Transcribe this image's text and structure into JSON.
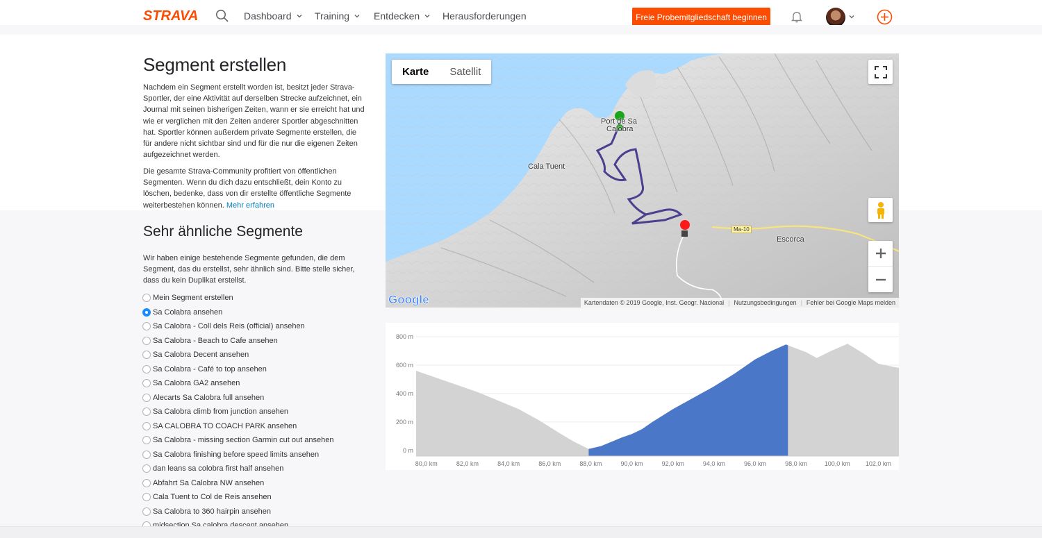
{
  "header": {
    "brand": "STRAVA",
    "nav": [
      {
        "label": "Dashboard",
        "has_dropdown": true
      },
      {
        "label": "Training",
        "has_dropdown": true
      },
      {
        "label": "Entdecken",
        "has_dropdown": true
      },
      {
        "label": "Herausforderungen",
        "has_dropdown": false
      }
    ],
    "cta": "Freie Probemitgliedschaft beginnen",
    "icons": [
      "search-icon",
      "bell-icon",
      "avatar",
      "chevron-down-icon",
      "plus-circle-icon"
    ],
    "brand_color": "#fc4c02"
  },
  "intro": {
    "title": "Segment erstellen",
    "p1": "Nachdem ein Segment erstellt worden ist, besitzt jeder Strava-Sportler, der eine Aktivität auf derselben Strecke aufzeichnet, ein Journal mit seinen bisherigen Zeiten, wann er sie erreicht hat und wie er verglichen mit den Zeiten anderer Sportler abgeschnitten hat. Sportler können außerdem private Segmente erstellen, die für andere nicht sichtbar sind und für die nur die eigenen Zeiten aufgezeichnet werden.",
    "p2": "Die gesamte Strava-Community profitiert von öffentlichen Segmenten. Wenn du dich dazu entschließt, dein Konto zu löschen, bedenke, dass von dir erstellte öffentliche Segmente weiterbestehen können.",
    "more_link": "Mehr erfahren"
  },
  "similar": {
    "title": "Sehr ähnliche Segmente",
    "description": "Wir haben einige bestehende Segmente gefunden, die dem Segment, das du erstellst, sehr ähnlich sind. Bitte stelle sicher, dass du kein Duplikat erstellst.",
    "selected_index": 1,
    "options": [
      "Mein Segment erstellen",
      "Sa Colabra ansehen",
      "Sa Calobra - Coll dels Reis (official) ansehen",
      "Sa Calobra - Beach to Cafe ansehen",
      "Sa Calobra Decent ansehen",
      "Sa Colabra - Café to top ansehen",
      "Sa Calobra GA2 ansehen",
      "Alecarts Sa Calobra full ansehen",
      "Sa Calobra climb from junction ansehen",
      "SA CALOBRA TO COACH PARK ansehen",
      "Sa Calobra - missing section Garmin cut out ansehen",
      "Sa Calobra finishing before speed limits ansehen",
      "dan leans sa colobra first half ansehen",
      "Abfahrt Sa Calobra NW ansehen",
      "Cala Tuent to Col de Reis ansehen",
      "Sa Calobra to 360 hairpin ansehen",
      "midsection Sa calobra descent ansehen"
    ]
  },
  "map": {
    "tab_map": "Karte",
    "tab_satellite": "Satellit",
    "active_tab": "Karte",
    "labels": {
      "place1a": "Port de Sa",
      "place1b": "Calobra",
      "place2": "Cala Tuent",
      "place3": "Escorca",
      "road": "Ma-10"
    },
    "google_logo": "Google",
    "attribution": "Kartendaten © 2019 Google, Inst. Geogr. Nacional",
    "terms": "Nutzungsbedingungen",
    "report": "Fehler bei Google Maps melden",
    "route_color": "#4b3f8f"
  },
  "chart_data": {
    "type": "area",
    "title": "",
    "xlabel": "",
    "ylabel": "",
    "x_unit": "km",
    "y_unit": "m",
    "xlim": [
      79.5,
      103
    ],
    "ylim": [
      -40,
      800
    ],
    "y_ticks": [
      "800 m",
      "600 m",
      "400 m",
      "200 m",
      "0 m"
    ],
    "y_tick_values": [
      800,
      600,
      400,
      200,
      0
    ],
    "x_ticks": [
      "80,0 km",
      "82,0 km",
      "84,0 km",
      "86,0 km",
      "88,0 km",
      "90,0 km",
      "92,0 km",
      "94,0 km",
      "96,0 km",
      "98,0 km",
      "100,0 km",
      "102,0 km"
    ],
    "x_tick_values": [
      80,
      82,
      84,
      86,
      88,
      90,
      92,
      94,
      96,
      98,
      100,
      102
    ],
    "series": [
      {
        "x": [
          79.5,
          80.5,
          81.5,
          82.5,
          83.5,
          84.5,
          85.5,
          86.5,
          87.2,
          87.9,
          88.5,
          89.0,
          89.5,
          90.0,
          90.5,
          91.0,
          92.0,
          93.0,
          94.0,
          95.0,
          96.0,
          96.8,
          97.5,
          98.5,
          99.0,
          99.7,
          100.5,
          101.3,
          102.0,
          103.0
        ],
        "y": [
          560,
          510,
          460,
          410,
          350,
          290,
          210,
          120,
          60,
          10,
          30,
          60,
          90,
          115,
          150,
          200,
          290,
          370,
          450,
          540,
          640,
          700,
          745,
          690,
          650,
          700,
          750,
          680,
          610,
          580
        ]
      }
    ],
    "highlight": {
      "from_km": 87.9,
      "to_km": 97.6,
      "color": "#4a77c8"
    },
    "base_color": "#d3d3d3",
    "grid": true
  }
}
